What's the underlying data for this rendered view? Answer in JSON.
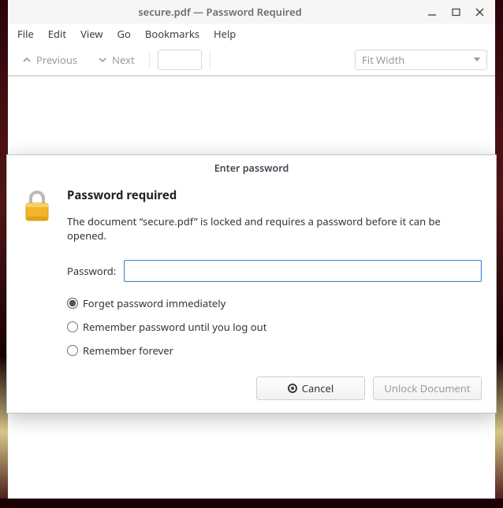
{
  "window": {
    "title": "secure.pdf — Password Required"
  },
  "menubar": {
    "items": [
      "File",
      "Edit",
      "View",
      "Go",
      "Bookmarks",
      "Help"
    ]
  },
  "toolbar": {
    "prev": "Previous",
    "next": "Next",
    "fit_label": "Fit Width"
  },
  "dialog": {
    "title": "Enter password",
    "heading": "Password required",
    "message": "The document “secure.pdf” is locked and requires a password before it can be opened.",
    "pw_label": "Password:",
    "pw_value": "",
    "radios": {
      "forget": "Forget password immediately",
      "until_logout": "Remember password until you log out",
      "forever": "Remember forever",
      "selected": "forget"
    },
    "cancel": "Cancel",
    "unlock": "Unlock Document"
  }
}
